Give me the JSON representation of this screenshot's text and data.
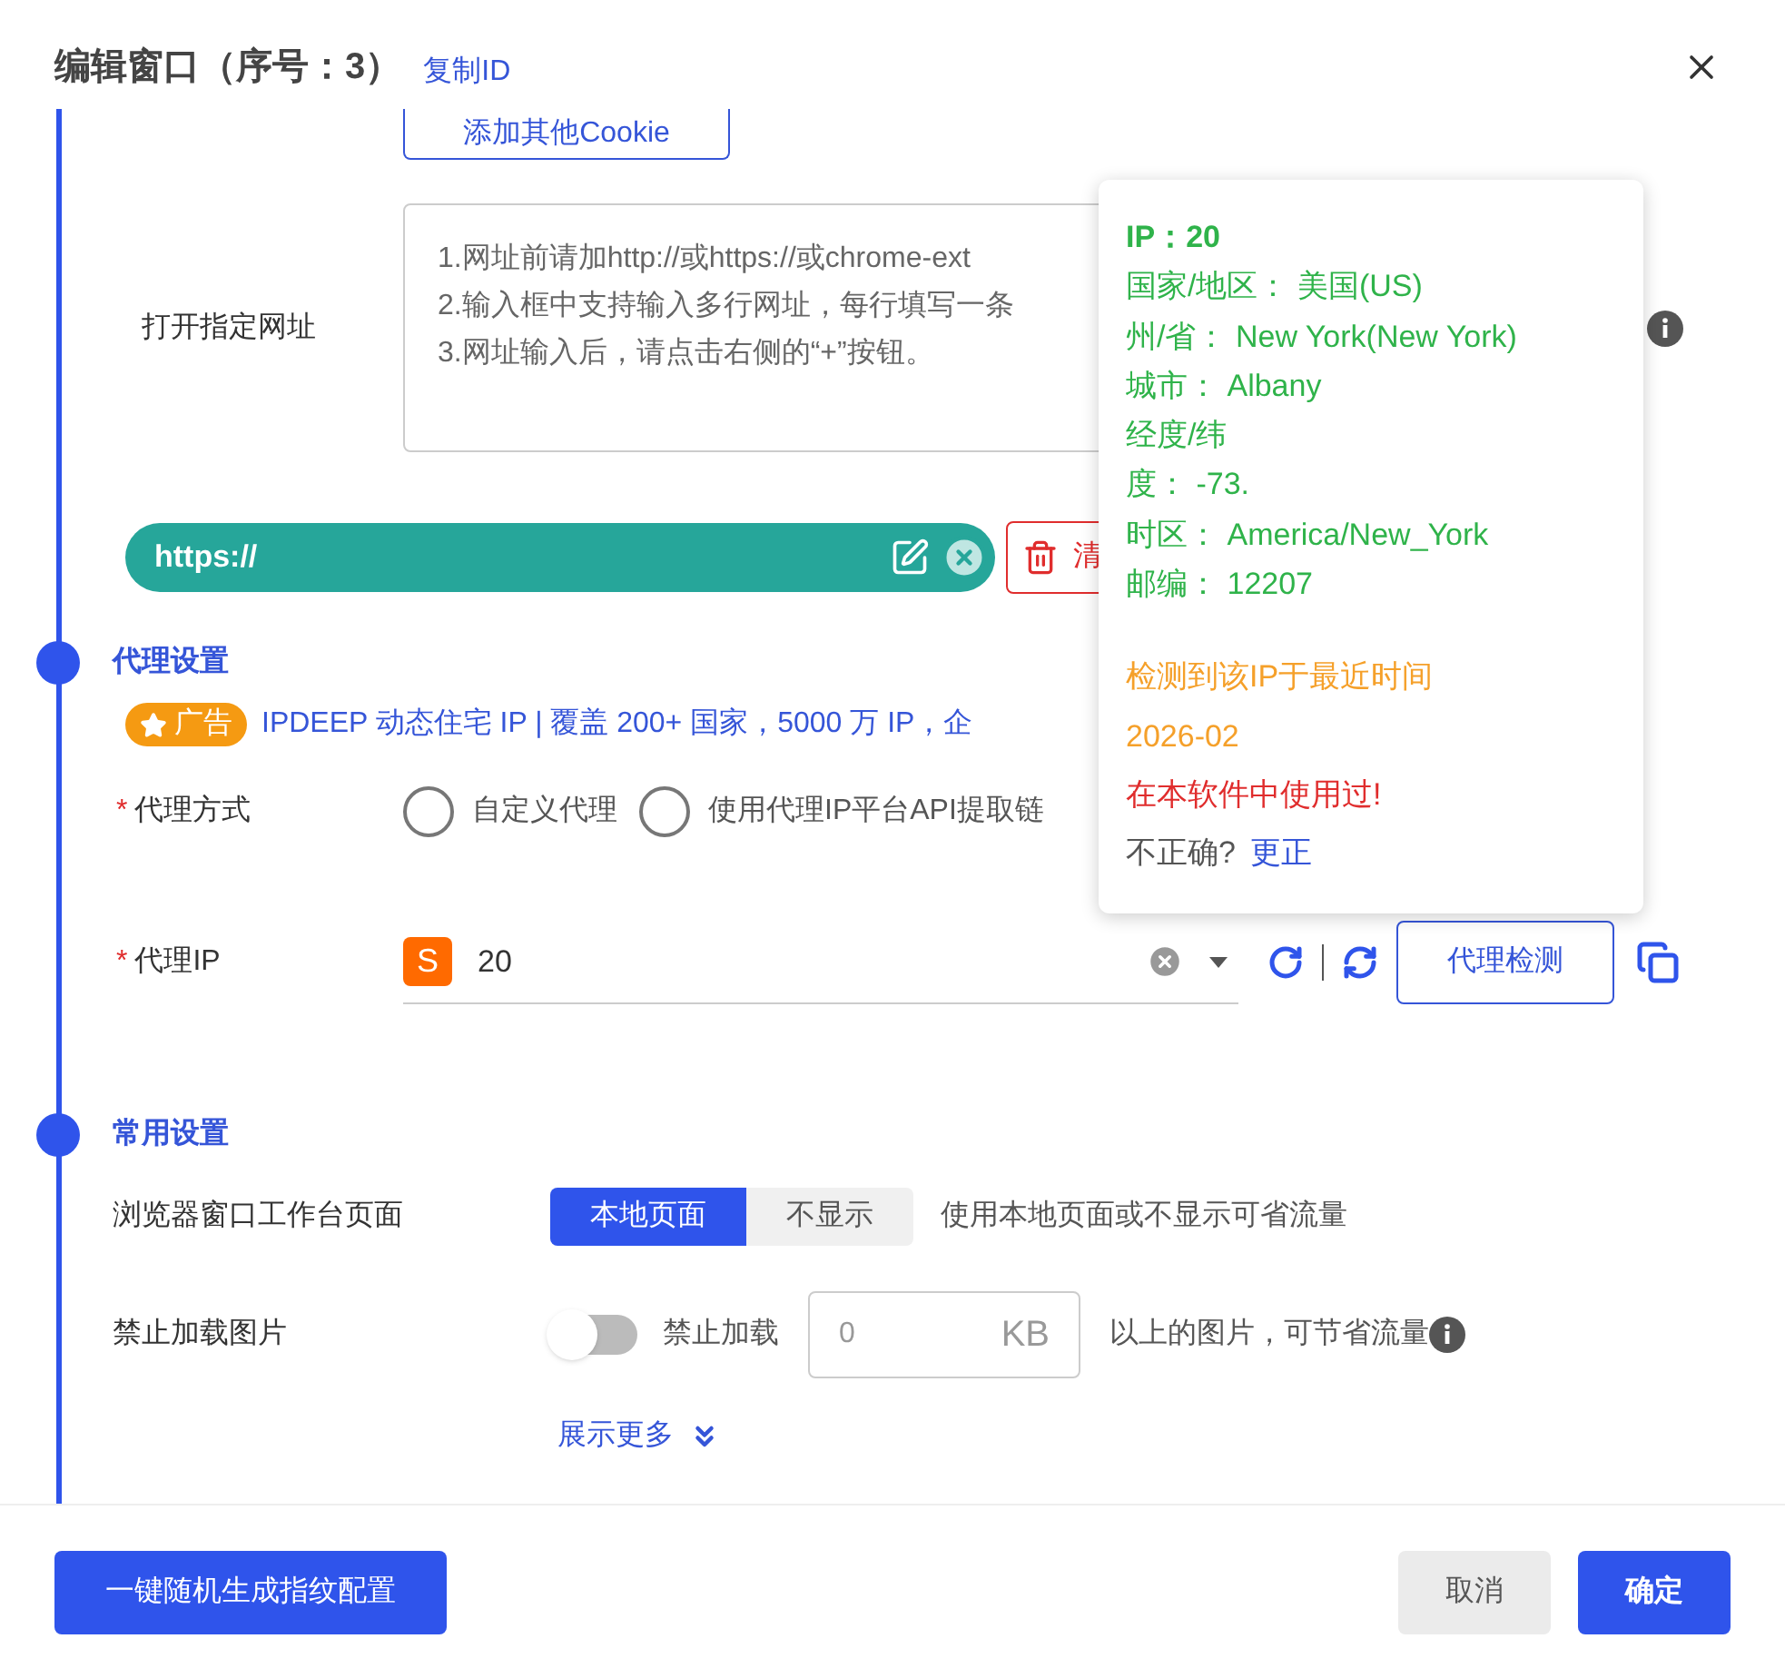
{
  "dialog": {
    "title": "编辑窗口（序号：3）",
    "copy_id_link": "复制ID"
  },
  "cookie_button": "添加其他Cookie",
  "open_url": {
    "label": "打开指定网址",
    "placeholder_lines": [
      "1.网址前请加http://或https://或chrome-ext",
      "2.输入框中支持输入多行网址，每行填写一条",
      "3.网址输入后，请点击右侧的“+”按钮。"
    ]
  },
  "url_chips": [
    {
      "text": "https://"
    }
  ],
  "clear_button": "清",
  "proxy_section": {
    "title": "代理设置",
    "ad": {
      "badge": "广告",
      "text": "IPDEEP 动态住宅 IP | 覆盖 200+ 国家，5000 万 IP，企"
    },
    "mode": {
      "label": "代理方式",
      "required_mark": "*",
      "options": [
        {
          "label": "自定义代理",
          "selected": false
        },
        {
          "label": "使用代理IP平台API提取链",
          "selected": false
        }
      ]
    },
    "ip": {
      "label": "代理IP",
      "required_mark": "*",
      "badge": "S",
      "value": "20",
      "check_button": "代理检测"
    }
  },
  "popover": {
    "ip_label": "IP：",
    "ip_value": "20",
    "rows": [
      {
        "kind": "pair",
        "label": "国家/地区：",
        "value": "美国(US)"
      },
      {
        "kind": "pair",
        "label": "州/省：",
        "value": "New York(New York)"
      },
      {
        "kind": "pair",
        "label": "城市：",
        "value": "Albany"
      },
      {
        "kind": "text",
        "text": "经度/纬"
      },
      {
        "kind": "pair",
        "label": "度：",
        "value": "-73."
      },
      {
        "kind": "pair",
        "label": "时区：",
        "value": "America/New_York"
      },
      {
        "kind": "pair",
        "label": "邮编：",
        "value": "12207"
      }
    ],
    "detected_label": "检测到该IP于最近时间",
    "detected_time": "2026-02",
    "used_notice": "在本软件中使用过!",
    "incorrect": "不正确?",
    "fix_link": "更正"
  },
  "common_section": {
    "title": "常用设置",
    "workbench": {
      "label": "浏览器窗口工作台页面",
      "options": [
        {
          "label": "本地页面",
          "selected": true
        },
        {
          "label": "不显示",
          "selected": false
        }
      ],
      "hint": "使用本地页面或不显示可省流量"
    },
    "images": {
      "label": "禁止加载图片",
      "on": false,
      "toggle_label": "禁止加载",
      "size_placeholder": "0",
      "unit": "KB",
      "hint": "以上的图片，可节省流量"
    },
    "show_more": "展示更多"
  },
  "footer": {
    "random_button": "一键随机生成指纹配置",
    "cancel_button": "取消",
    "ok_button": "确定"
  }
}
